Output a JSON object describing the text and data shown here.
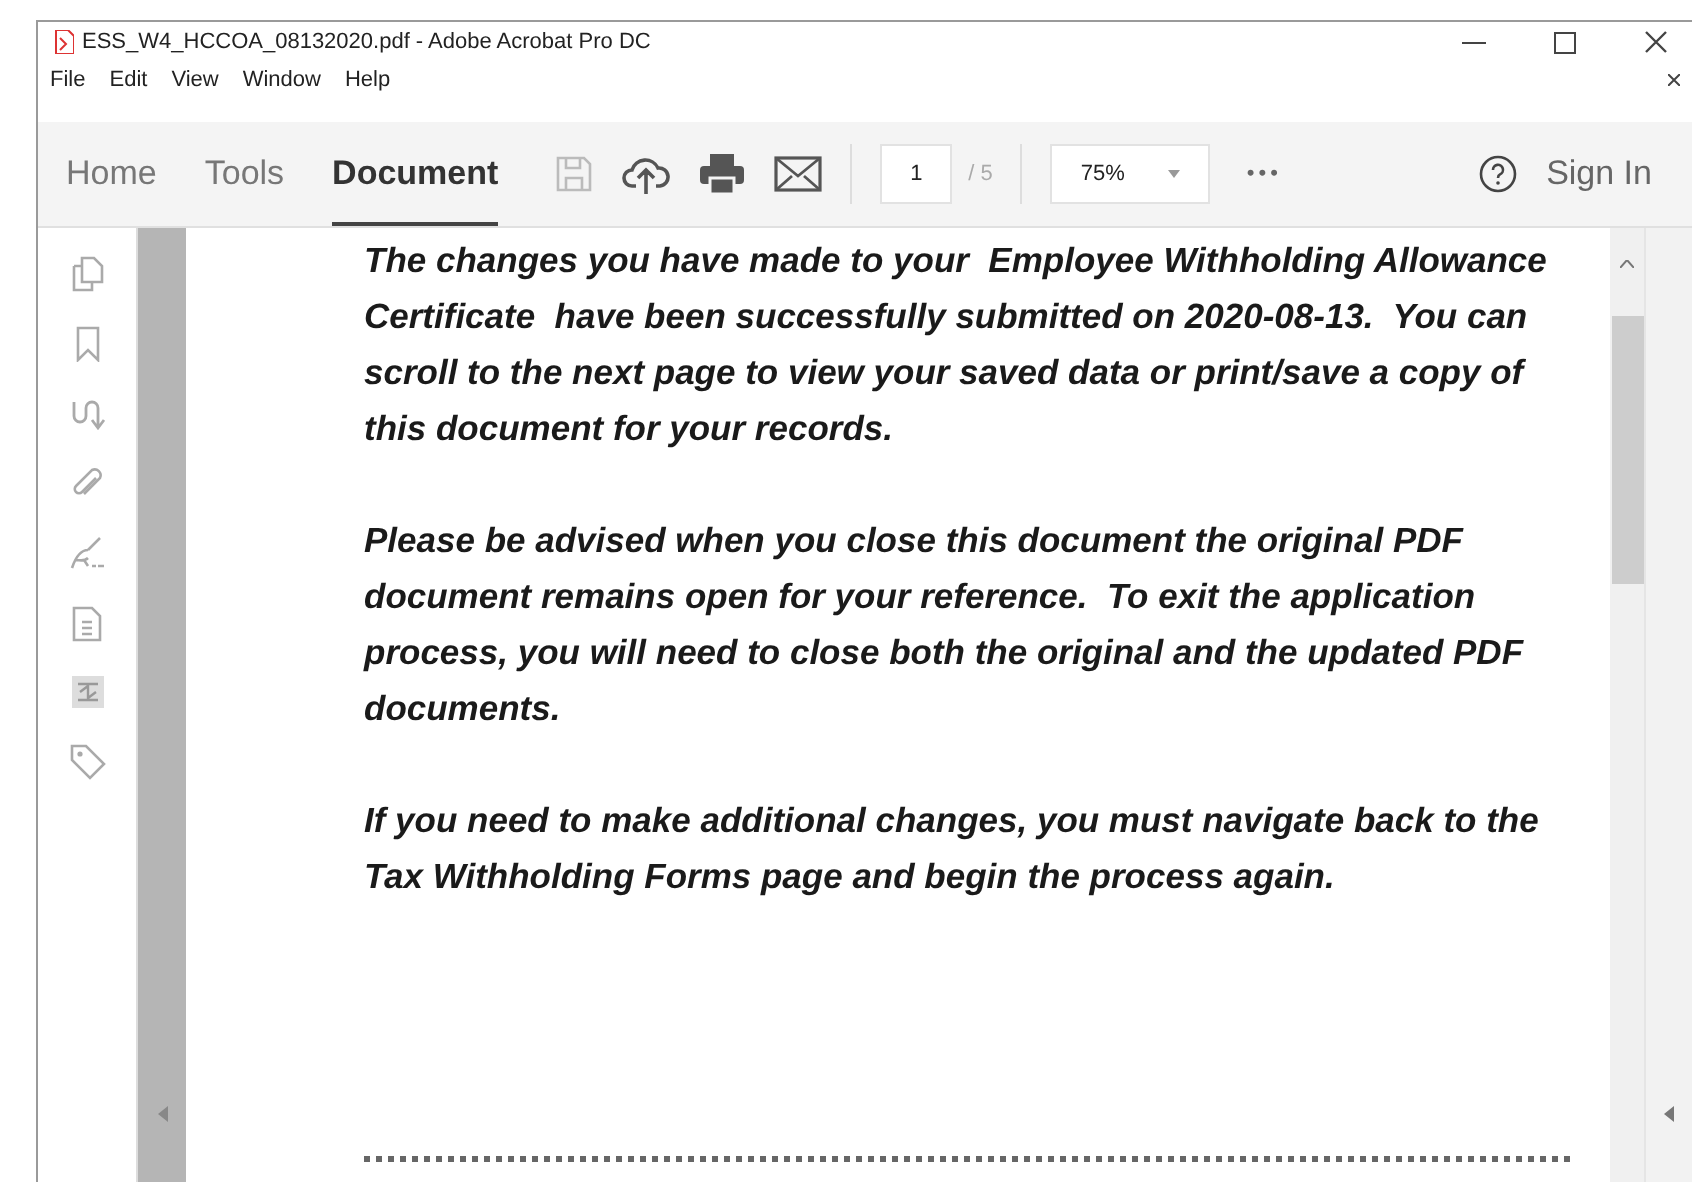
{
  "window": {
    "title": "ESS_W4_HCCOA_08132020.pdf - Adobe Acrobat Pro DC"
  },
  "menu": [
    "File",
    "Edit",
    "View",
    "Window",
    "Help"
  ],
  "tabs": [
    {
      "label": "Home",
      "selected": false
    },
    {
      "label": "Tools",
      "selected": false
    },
    {
      "label": "Document",
      "selected": true
    }
  ],
  "toolbar": {
    "page": "1",
    "page_total": "/ 5",
    "zoom": "75%",
    "more": "•••",
    "sign_in": "Sign In"
  },
  "document": {
    "paragraphs": [
      "The changes you have made to your  Employee Withholding Allowance Certificate  have been successfully submitted on 2020-08-13.  You can scroll to the next page to view your saved data or print/save a copy of this document for your records.",
      "Please be advised when you close this document the original PDF document remains open for your reference.  To exit the application process, you will need to close both the original and the updated PDF documents.",
      "If you need to make additional changes, you must navigate back to the Tax Withholding Forms page and begin the process again."
    ]
  }
}
